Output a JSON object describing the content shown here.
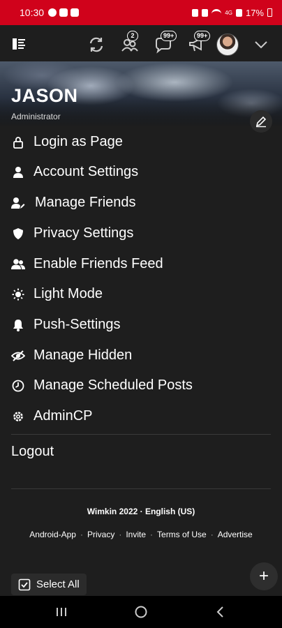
{
  "status_bar": {
    "time": "10:30",
    "battery": "17%",
    "network": "4G"
  },
  "toolbar": {
    "menu_icon": "menu-icon",
    "refresh_icon": "refresh-icon",
    "friends_badge": "2",
    "messages_badge": "99+",
    "notifications_badge": "99+",
    "avatar_icon": "avatar",
    "dropdown_icon": "chevron-down-icon"
  },
  "profile": {
    "name": "JASON",
    "role": "Administrator"
  },
  "menu": {
    "items": [
      {
        "label": "Login as Page",
        "icon": "lock-icon"
      },
      {
        "label": "Account Settings",
        "icon": "user-icon"
      },
      {
        "label": "Manage Friends",
        "icon": "user-edit-icon"
      },
      {
        "label": "Privacy Settings",
        "icon": "shield-icon"
      },
      {
        "label": "Enable Friends Feed",
        "icon": "users-icon"
      },
      {
        "label": "Light Mode",
        "icon": "sun-icon"
      },
      {
        "label": "Push-Settings",
        "icon": "bell-icon"
      },
      {
        "label": "Manage Hidden",
        "icon": "eye-slash-icon"
      },
      {
        "label": "Manage Scheduled Posts",
        "icon": "clock-icon"
      },
      {
        "label": "AdminCP",
        "icon": "gear-icon"
      }
    ],
    "logout": "Logout"
  },
  "footer": {
    "copyright": "Wimkin 2022 · English (US)",
    "links": [
      "Android-App",
      "Privacy",
      "Invite",
      "Terms of Use",
      "Advertise"
    ]
  },
  "select_all": "Select All",
  "fab": "+",
  "colors": {
    "status_bar": "#d0021b",
    "background": "#1e1e1e"
  }
}
